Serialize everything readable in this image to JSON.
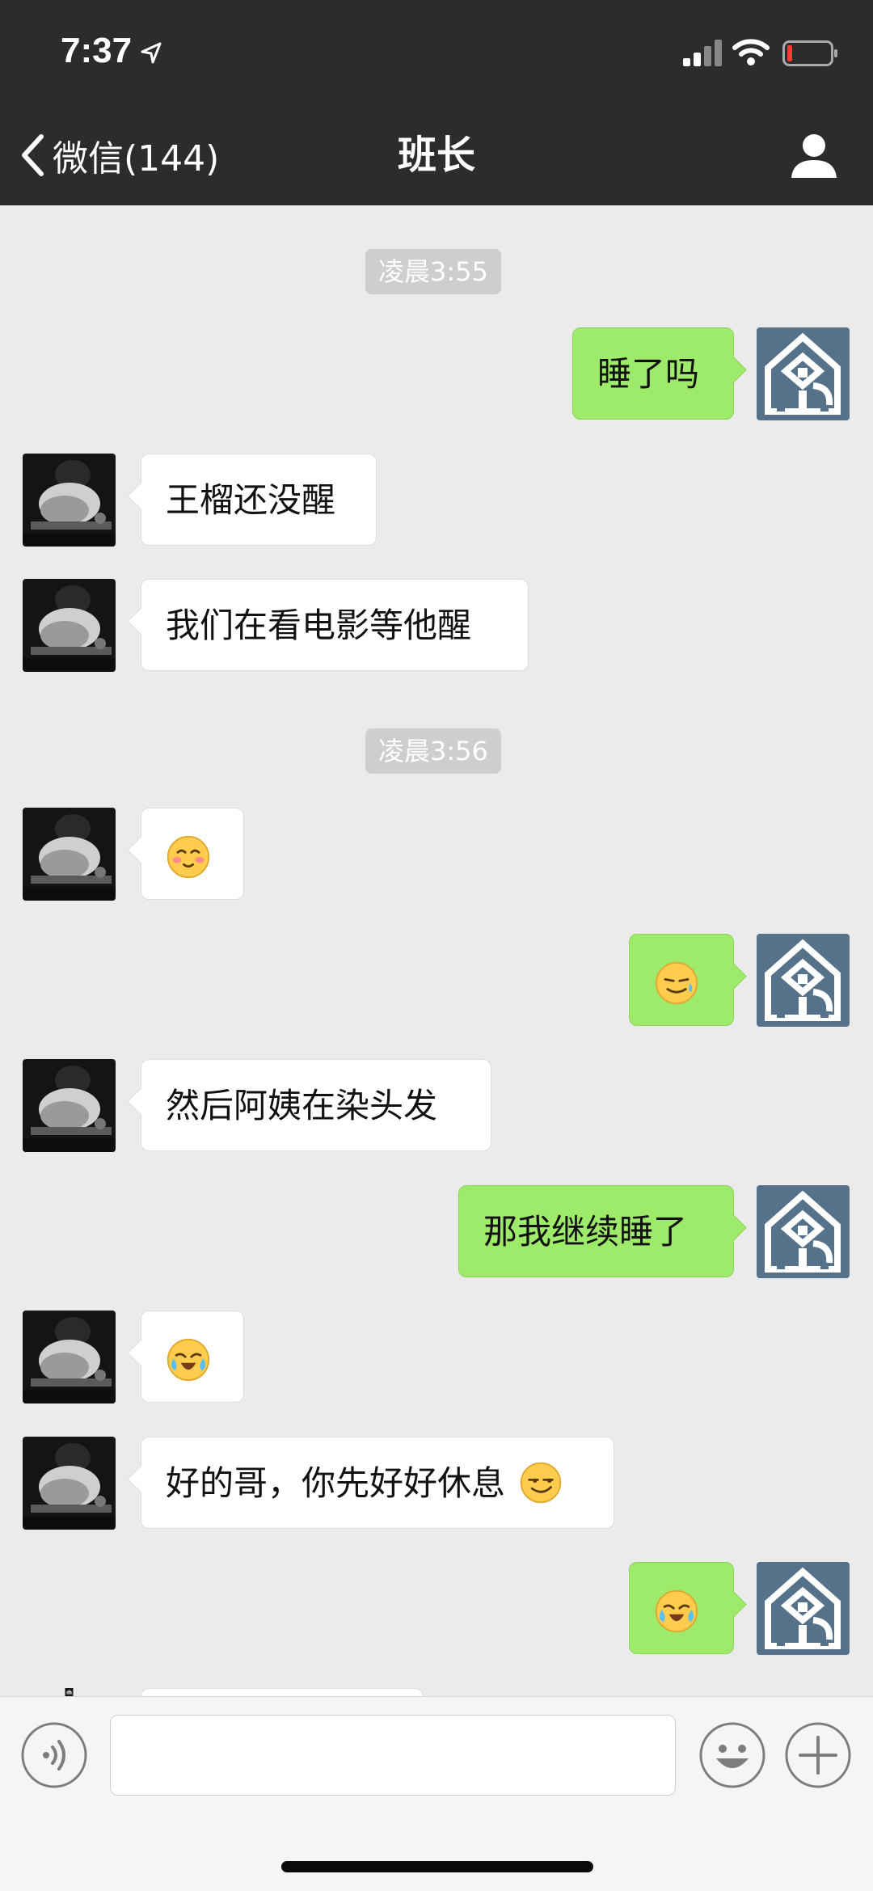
{
  "status_bar": {
    "time": "7:37"
  },
  "nav": {
    "back_label": "微信(144)",
    "title": "班长"
  },
  "messages": [
    {
      "type": "time",
      "text": "凌晨3:55"
    },
    {
      "type": "sent",
      "text": "睡了吗"
    },
    {
      "type": "received",
      "text": "王榴还没醒"
    },
    {
      "type": "received",
      "text": "我们在看电影等他醒"
    },
    {
      "type": "time",
      "text": "凌晨3:56"
    },
    {
      "type": "received",
      "emoji": "blushing-smile-emoji"
    },
    {
      "type": "sent",
      "emoji": "sweat-smile-emoji"
    },
    {
      "type": "received",
      "text": "然后阿姨在染头发"
    },
    {
      "type": "sent",
      "text": "那我继续睡了"
    },
    {
      "type": "received",
      "emoji": "crying-emoji"
    },
    {
      "type": "received",
      "text": "好的哥，你先好好休息",
      "emoji": "grinning-sly-emoji"
    },
    {
      "type": "sent",
      "emoji": "crying-emoji"
    }
  ],
  "input": {
    "placeholder": ""
  },
  "colors": {
    "nav_bg": "#2b2c2e",
    "chat_bg": "#ebebeb",
    "sent_bubble": "#9eea6a",
    "received_bubble": "#ffffff",
    "timestamp_bg": "#cecece"
  }
}
